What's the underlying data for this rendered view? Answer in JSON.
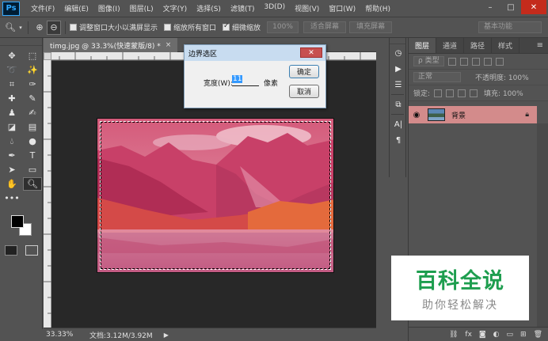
{
  "app": {
    "logo": "Ps"
  },
  "menu": [
    "文件(F)",
    "编辑(E)",
    "图像(I)",
    "图层(L)",
    "文字(Y)",
    "选择(S)",
    "滤镜(T)",
    "3D(D)",
    "视图(V)",
    "窗口(W)",
    "帮助(H)"
  ],
  "window_controls": {
    "minimize": "–",
    "restore": "□",
    "close": "✕"
  },
  "options": {
    "resize_window": "调整窗口大小以满屏显示",
    "zoom_all_windows": "缩放所有窗口",
    "scrubby_zoom": "细微缩放",
    "zoom_value": "100%",
    "fit_screen": "适合屏幕",
    "fill_screen": "填充屏幕",
    "workspace": "基本功能"
  },
  "document": {
    "tab_title": "timg.jpg @ 33.3%(快速蒙版/8) *",
    "tab_close": "×",
    "status_zoom": "33.33%",
    "status_info": "文档:3.12M/3.92M"
  },
  "dialog": {
    "title": "边界选区",
    "close": "✕",
    "width_label": "宽度(W):",
    "width_value": "11",
    "unit": "像素",
    "ok": "确定",
    "cancel": "取消"
  },
  "layers_panel": {
    "tabs": [
      "图层",
      "通道",
      "路径",
      "样式"
    ],
    "kind_filter": "ρ 类型",
    "blend_mode": "正常",
    "opacity": "不透明度: 100%",
    "lock_label": "锁定:",
    "fill": "填充: 100%",
    "layer_name": "背景"
  },
  "watermark": {
    "title": "百科全说",
    "subtitle": "助你轻松解决"
  },
  "colors": {
    "fg": "#000000",
    "bg": "#ffffff",
    "accent": "#31a8ff",
    "selected_layer": "#d38b8b",
    "watermark_green": "#1e9e4f"
  }
}
